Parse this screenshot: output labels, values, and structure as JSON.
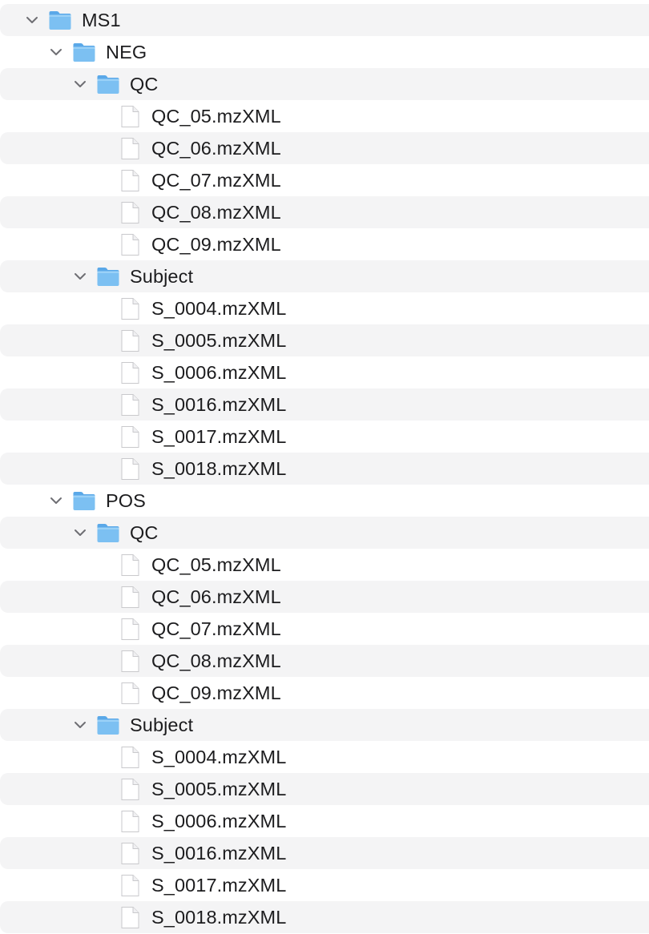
{
  "tree": [
    {
      "type": "folder",
      "level": 0,
      "label": "MS1"
    },
    {
      "type": "folder",
      "level": 1,
      "label": "NEG"
    },
    {
      "type": "folder",
      "level": 2,
      "label": "QC"
    },
    {
      "type": "file",
      "level": 3,
      "label": "QC_05.mzXML"
    },
    {
      "type": "file",
      "level": 3,
      "label": "QC_06.mzXML"
    },
    {
      "type": "file",
      "level": 3,
      "label": "QC_07.mzXML"
    },
    {
      "type": "file",
      "level": 3,
      "label": "QC_08.mzXML"
    },
    {
      "type": "file",
      "level": 3,
      "label": "QC_09.mzXML"
    },
    {
      "type": "folder",
      "level": 2,
      "label": "Subject"
    },
    {
      "type": "file",
      "level": 3,
      "label": "S_0004.mzXML"
    },
    {
      "type": "file",
      "level": 3,
      "label": "S_0005.mzXML"
    },
    {
      "type": "file",
      "level": 3,
      "label": "S_0006.mzXML"
    },
    {
      "type": "file",
      "level": 3,
      "label": "S_0016.mzXML"
    },
    {
      "type": "file",
      "level": 3,
      "label": "S_0017.mzXML"
    },
    {
      "type": "file",
      "level": 3,
      "label": "S_0018.mzXML"
    },
    {
      "type": "folder",
      "level": 1,
      "label": "POS"
    },
    {
      "type": "folder",
      "level": 2,
      "label": "QC"
    },
    {
      "type": "file",
      "level": 3,
      "label": "QC_05.mzXML"
    },
    {
      "type": "file",
      "level": 3,
      "label": "QC_06.mzXML"
    },
    {
      "type": "file",
      "level": 3,
      "label": "QC_07.mzXML"
    },
    {
      "type": "file",
      "level": 3,
      "label": "QC_08.mzXML"
    },
    {
      "type": "file",
      "level": 3,
      "label": "QC_09.mzXML"
    },
    {
      "type": "folder",
      "level": 2,
      "label": "Subject"
    },
    {
      "type": "file",
      "level": 3,
      "label": "S_0004.mzXML"
    },
    {
      "type": "file",
      "level": 3,
      "label": "S_0005.mzXML"
    },
    {
      "type": "file",
      "level": 3,
      "label": "S_0006.mzXML"
    },
    {
      "type": "file",
      "level": 3,
      "label": "S_0016.mzXML"
    },
    {
      "type": "file",
      "level": 3,
      "label": "S_0017.mzXML"
    },
    {
      "type": "file",
      "level": 3,
      "label": "S_0018.mzXML"
    }
  ],
  "icons": {
    "folder": "folder-icon",
    "file": "document-icon",
    "disclosure": "chevron-down-icon"
  },
  "colors": {
    "folder_fill": "#7cc0f2",
    "folder_tab": "#5aa8e8",
    "stripe": "#f4f4f5",
    "text": "#1c1c1e",
    "chevron": "#6e6e73"
  }
}
